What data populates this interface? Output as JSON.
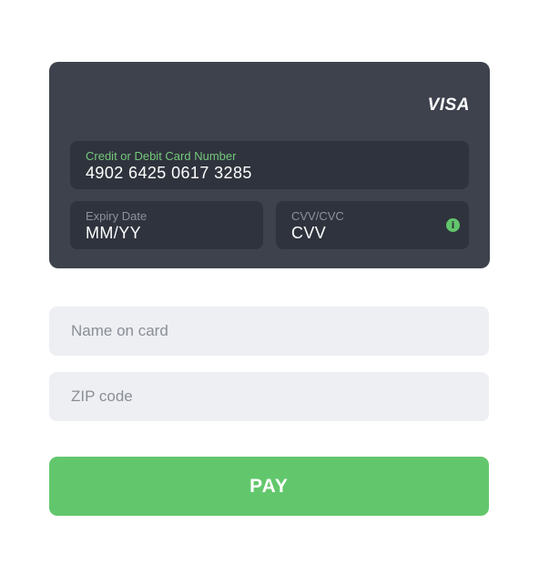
{
  "card": {
    "brand": "VISA",
    "number": {
      "label": "Credit or Debit Card Number",
      "value": "4902 6425 0617 3285"
    },
    "expiry": {
      "label": "Expiry Date",
      "value": "MM/YY"
    },
    "cvv": {
      "label": "CVV/CVC",
      "value": "CVV",
      "icon": "info-icon"
    }
  },
  "form": {
    "name_placeholder": "Name on card",
    "zip_placeholder": "ZIP code"
  },
  "pay_button": {
    "label": "PAY"
  },
  "colors": {
    "card_bg": "#3d424d",
    "field_dark_bg": "#2f333d",
    "accent_green": "#62c76c",
    "active_label": "#74c77b",
    "light_field_bg": "#eeeff3"
  }
}
